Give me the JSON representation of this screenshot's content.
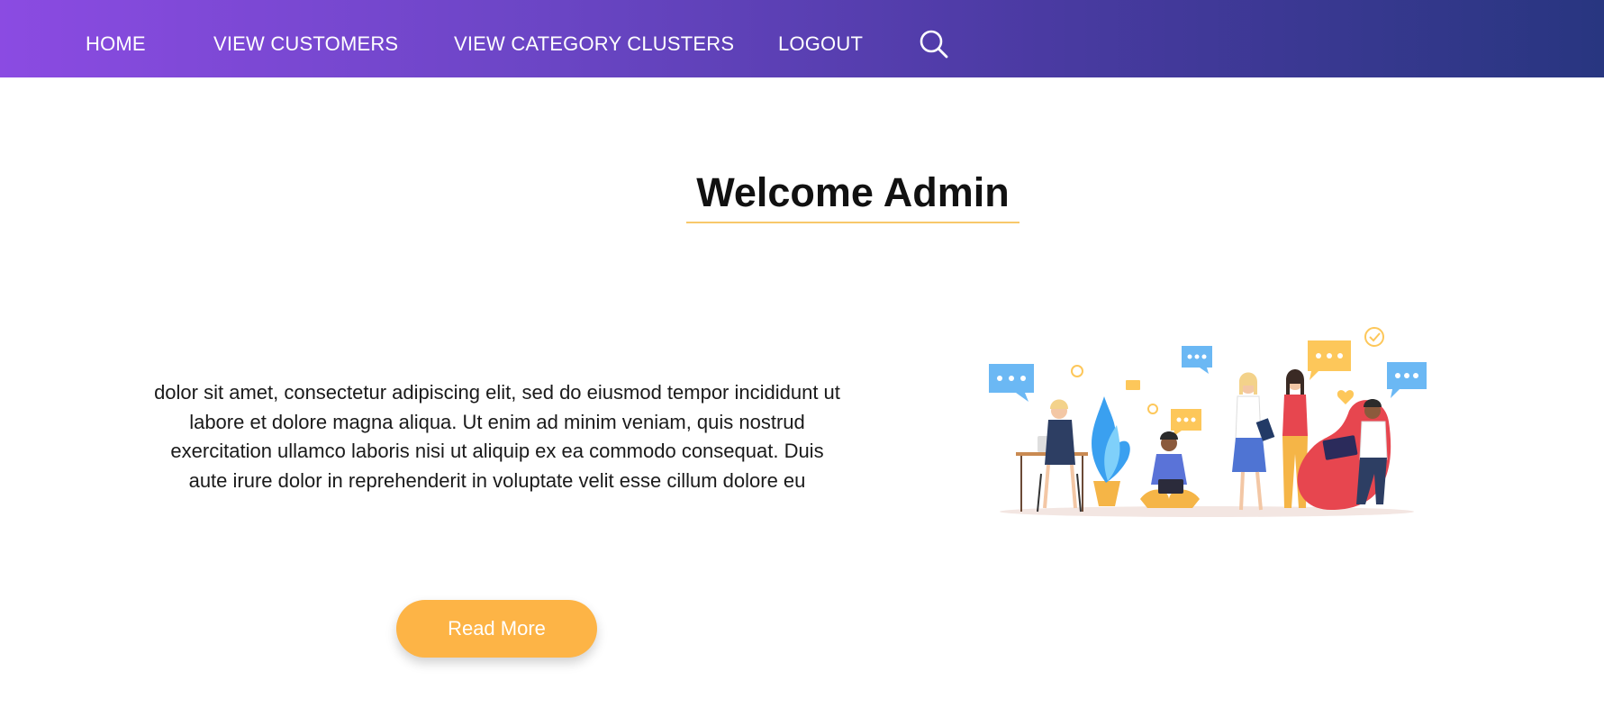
{
  "nav": {
    "items": [
      {
        "label": "HOME"
      },
      {
        "label": "VIEW CUSTOMERS"
      },
      {
        "label": "VIEW CATEGORY CLUSTERS"
      },
      {
        "label": "LOGOUT"
      }
    ],
    "search_icon": "search-icon"
  },
  "main": {
    "title": "Welcome Admin",
    "body": "dolor sit amet, consectetur adipiscing elit, sed do eiusmod tempor incididunt ut labore et dolore magna aliqua. Ut enim ad minim veniam, quis nostrud exercitation ullamco laboris nisi ut aliquip ex ea commodo consequat. Duis aute irure dolor in reprehenderit in voluptate velit esse cillum dolore eu",
    "read_more_label": "Read More"
  },
  "colors": {
    "nav_gradient_start": "#8b4be2",
    "nav_gradient_end": "#283680",
    "accent": "#fdb446",
    "underline": "#f8c86b"
  }
}
